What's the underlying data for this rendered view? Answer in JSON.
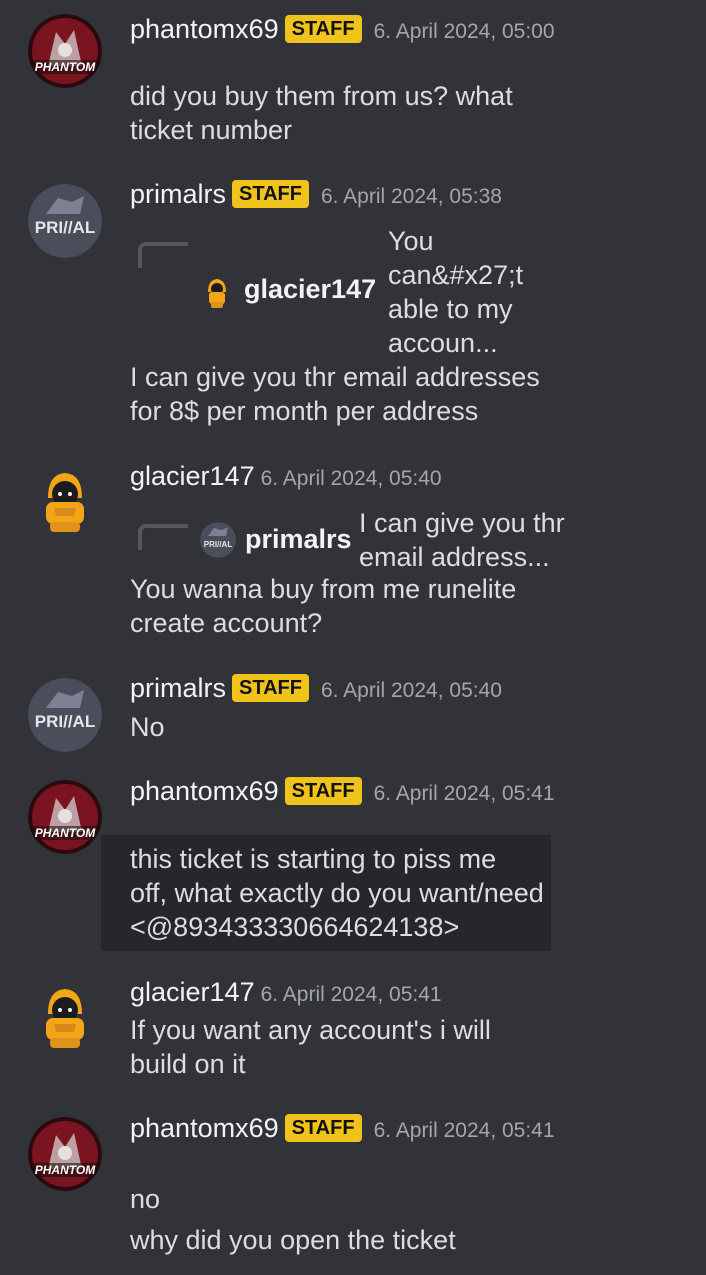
{
  "messages": [
    {
      "username": "phantomx69",
      "badge": "STAFF",
      "timestamp": "6. April 2024, 05:00",
      "avatar_label": "PHANTOM",
      "lines": [
        "did you buy them from us? what",
        "ticket number"
      ]
    },
    {
      "username": "primalrs",
      "badge": "STAFF",
      "timestamp": "6. April 2024, 05:38",
      "avatar_label": "PRI//AL",
      "reply": {
        "username": "glacier147",
        "lines": [
          "You",
          "can&#x27;t",
          "able to my",
          "accoun..."
        ]
      },
      "lines": [
        "I can give you thr email addresses",
        "for 8$ per month per address"
      ]
    },
    {
      "username": "glacier147",
      "timestamp": "6. April 2024, 05:40",
      "reply": {
        "username": "primalrs",
        "avatar_label": "PRI//AL",
        "lines": [
          "I can give you thr",
          "email address..."
        ]
      },
      "lines": [
        "You wanna buy from me runelite",
        "create account?"
      ]
    },
    {
      "username": "primalrs",
      "badge": "STAFF",
      "timestamp": "6. April 2024, 05:40",
      "avatar_label": "PRI//AL",
      "lines": [
        "No"
      ]
    },
    {
      "username": "phantomx69",
      "badge": "STAFF",
      "timestamp": "6. April 2024, 05:41",
      "avatar_label": "PHANTOM",
      "lines": [
        "this ticket is starting to piss me",
        "off, what exactly do you want/need",
        "<@893433330664624138>"
      ]
    },
    {
      "username": "glacier147",
      "timestamp": "6. April 2024, 05:41",
      "lines": [
        "If you want any account's i will",
        "build on it"
      ]
    },
    {
      "username": "phantomx69",
      "badge": "STAFF",
      "timestamp": "6. April 2024, 05:41",
      "avatar_label": "PHANTOM",
      "lines": [
        "no",
        "why did you open the ticket"
      ]
    }
  ],
  "colors": {
    "background": "#313338",
    "badge": "#f0c31a",
    "highlight": "#26272a"
  }
}
